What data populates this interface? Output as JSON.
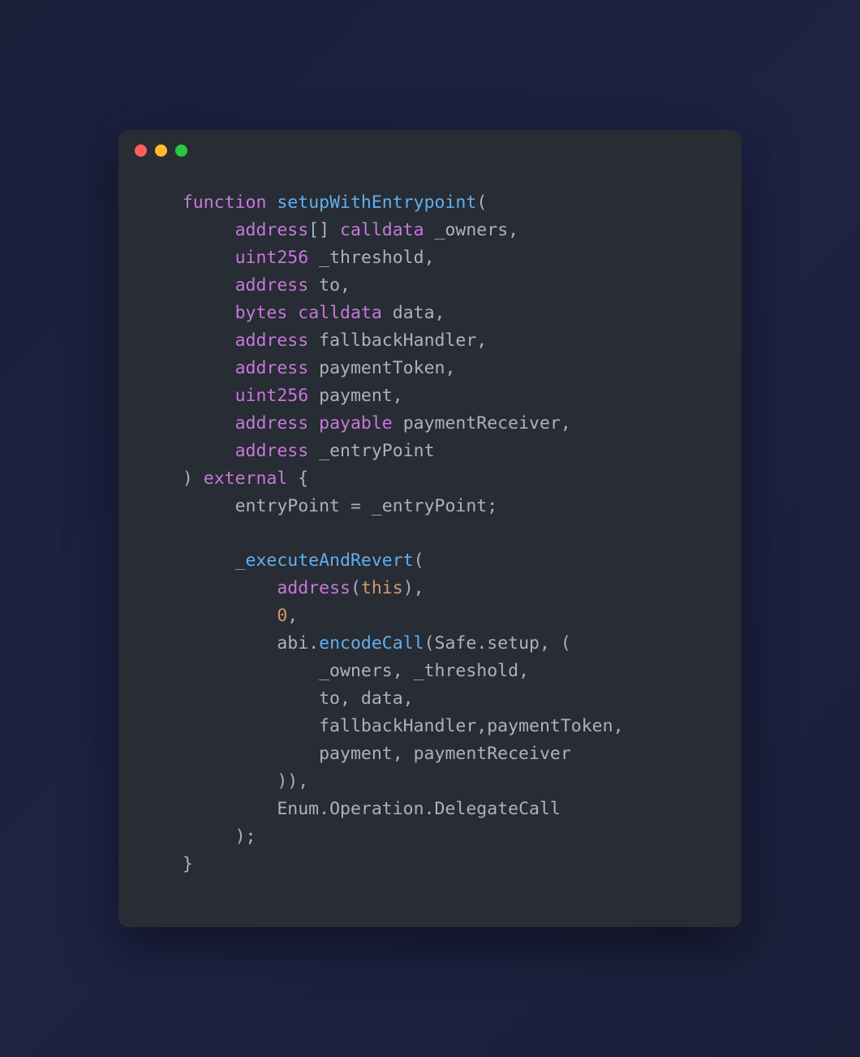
{
  "traffic_lights": {
    "red": "#ff5f56",
    "yellow": "#ffbd2e",
    "green": "#27c93f"
  },
  "code": {
    "line1_kw": "function",
    "line1_fn": "setupWithEntrypoint",
    "line1_paren": "(",
    "l2_type": "address",
    "l2_brackets": "[]",
    "l2_kw": "calldata",
    "l2_name": "_owners",
    "l2_comma": ",",
    "l3_type": "uint256",
    "l3_name": "_threshold",
    "l3_comma": ",",
    "l4_type": "address",
    "l4_name": "to",
    "l4_comma": ",",
    "l5_type": "bytes",
    "l5_kw": "calldata",
    "l5_name": "data",
    "l5_comma": ",",
    "l6_type": "address",
    "l6_name": "fallbackHandler",
    "l6_comma": ",",
    "l7_type": "address",
    "l7_name": "paymentToken",
    "l7_comma": ",",
    "l8_type": "uint256",
    "l8_name": "payment",
    "l8_comma": ",",
    "l9_type": "address",
    "l9_kw": "payable",
    "l9_name": "paymentReceiver",
    "l9_comma": ",",
    "l10_type": "address",
    "l10_name": "_entryPoint",
    "l11_close": ")",
    "l11_kw": "external",
    "l11_brace": "{",
    "l12_lhs": "entryPoint",
    "l12_eq": " = ",
    "l12_rhs": "_entryPoint",
    "l12_semi": ";",
    "l14_fn": "_executeAndRevert",
    "l14_open": "(",
    "l15_type": "address",
    "l15_open": "(",
    "l15_this": "this",
    "l15_close": ")",
    "l15_comma": ",",
    "l16_num": "0",
    "l16_comma": ",",
    "l17_abi": "abi",
    "l17_dot1": ".",
    "l17_enc": "encodeCall",
    "l17_open": "(",
    "l17_safe": "Safe",
    "l17_dot2": ".",
    "l17_setup": "setup",
    "l17_comma": ",",
    "l17_tuple": " (",
    "l18_a": "_owners",
    "l18_c1": ", ",
    "l18_b": "_threshold",
    "l18_c2": ",",
    "l19_a": "to",
    "l19_c1": ", ",
    "l19_b": "data",
    "l19_c2": ",",
    "l20_a": "fallbackHandler",
    "l20_c1": ",",
    "l20_b": "paymentToken",
    "l20_c2": ",",
    "l21_a": "payment",
    "l21_c1": ", ",
    "l21_b": "paymentReceiver",
    "l22_close": "))",
    "l22_comma": ",",
    "l23_enum": "Enum",
    "l23_d1": ".",
    "l23_op": "Operation",
    "l23_d2": ".",
    "l23_dc": "DelegateCall",
    "l24_close": ")",
    "l24_semi": ";",
    "l25_brace": "}"
  }
}
